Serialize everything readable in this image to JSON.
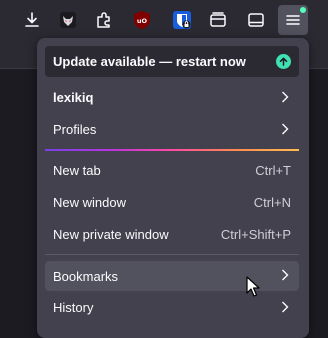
{
  "toolbar": {
    "icons": [
      "download-icon",
      "fox-avatar-icon",
      "extensions-icon",
      "ublock-icon",
      "bitwarden-icon",
      "container-icon",
      "sidebar-icon",
      "app-menu-icon"
    ],
    "notification_color": "#54ffbd"
  },
  "menu": {
    "update_banner": "Update available — restart now",
    "account": "lexikiq",
    "profiles": "Profiles",
    "new_tab": {
      "label": "New tab",
      "shortcut": "Ctrl+T"
    },
    "new_window": {
      "label": "New window",
      "shortcut": "Ctrl+N"
    },
    "new_private_window": {
      "label": "New private window",
      "shortcut": "Ctrl+Shift+P"
    },
    "bookmarks": "Bookmarks",
    "history": "History"
  },
  "colors": {
    "accent_green": "#3fe1b0",
    "menu_bg": "#42414d",
    "hover_bg": "#52525e"
  }
}
